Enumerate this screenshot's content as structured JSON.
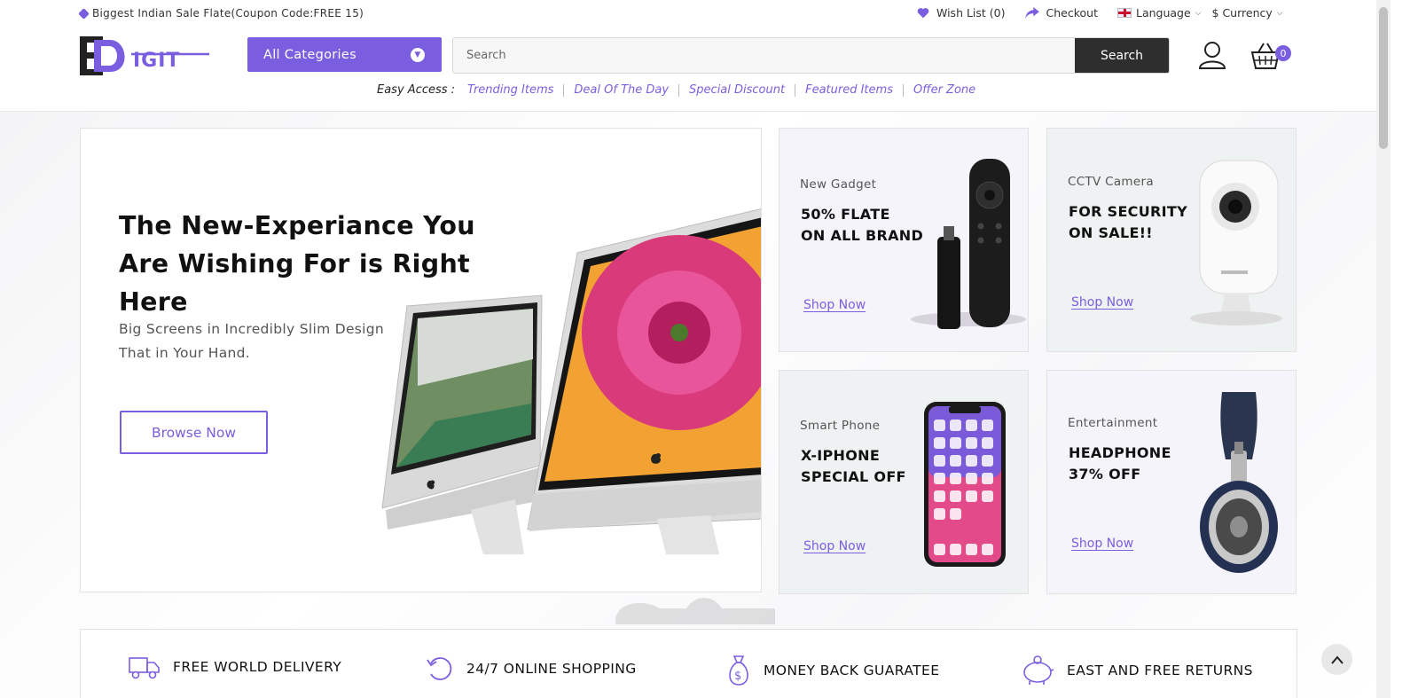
{
  "topbar": {
    "promo": "Biggest Indian Sale Flate(Coupon Code:FREE 15)",
    "wishlist": "Wish List (0)",
    "checkout": "Checkout",
    "language": "Language",
    "currency": "$ Currency"
  },
  "header": {
    "logo_text": "EDigit",
    "categories_label": "All Categories",
    "search": {
      "placeholder": "Search",
      "button": "Search"
    },
    "cart_count": "0",
    "easy_access": {
      "label": "Easy Access :",
      "links": [
        "Trending Items",
        "Deal Of The Day",
        "Special Discount",
        "Featured Items",
        "Offer Zone"
      ]
    }
  },
  "hero": {
    "headline": "The New-Experiance You Are Wishing For is Right Here",
    "subtext": "Big Screens in Incredibly Slim Design That in Your Hand.",
    "button": "Browse Now"
  },
  "promos": [
    {
      "category": "New Gadget",
      "title_line1": "50% FLATE",
      "title_line2": "ON ALL BRAND",
      "cta": "Shop Now",
      "bg": "#f6f4fb"
    },
    {
      "category": "CCTV Camera",
      "title_line1": "FOR SECURITY",
      "title_line2": "ON SALE!!",
      "cta": "Shop Now",
      "bg": "#eef2f2"
    },
    {
      "category": "Smart Phone",
      "title_line1": "X-IPHONE",
      "title_line2": "SPECIAL OFF",
      "cta": "Shop Now",
      "bg": "#eef2f2"
    },
    {
      "category": "Entertainment",
      "title_line1": "HEADPHONE",
      "title_line2": "37% OFF",
      "cta": "Shop Now",
      "bg": "#f6f4fb"
    }
  ],
  "features": [
    "FREE WORLD DELIVERY",
    "24/7 ONLINE SHOPPING",
    "MONEY BACK GUARATEE",
    "EAST AND FREE RETURNS"
  ],
  "colors": {
    "accent": "#7b5ee0",
    "dark": "#2e2e2e"
  }
}
